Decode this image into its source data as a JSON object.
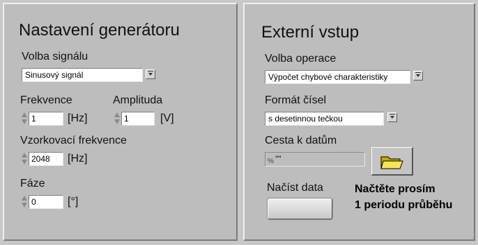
{
  "generator": {
    "title": "Nastavení generátoru",
    "signal": {
      "label": "Volba signálu",
      "value": "Sinusový signál"
    },
    "frequency": {
      "label": "Frekvence",
      "value": "1",
      "unit": "[Hz]"
    },
    "amplitude": {
      "label": "Amplituda",
      "value": "1",
      "unit": "[V]"
    },
    "sampling": {
      "label": "Vzorkovací frekvence",
      "value": "2048",
      "unit": "[Hz]"
    },
    "phase": {
      "label": "Fáze",
      "value": "0",
      "unit": "[°]"
    }
  },
  "external": {
    "title": "Externí vstup",
    "operation": {
      "label": "Volba operace",
      "value": "Výpočet chybové charakteristiky"
    },
    "number_format": {
      "label": "Formát čísel",
      "value": "s desetinnou tečkou"
    },
    "path": {
      "label": "Cesta k datům",
      "glyph": "%",
      "value": "\"\""
    },
    "load": {
      "label": "Načíst data"
    },
    "note_line1": "Načtěte prosím",
    "note_line2": "1 periodu průběhu"
  }
}
